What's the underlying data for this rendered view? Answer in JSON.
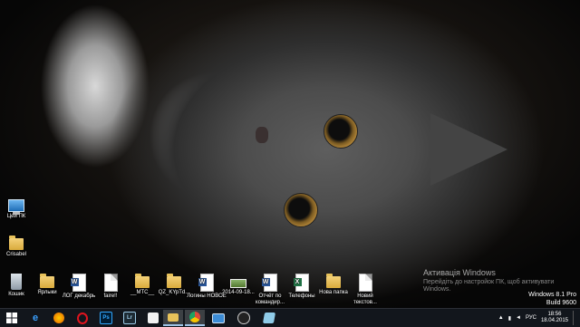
{
  "desktop": {
    "left_icons": [
      {
        "name": "this-pc",
        "label": "Цей ПК",
        "icon": "pc-icon"
      },
      {
        "name": "crisabel",
        "label": "Crisabel",
        "icon": "folder-icon"
      }
    ],
    "bottom_icons": [
      {
        "label": "Кошик",
        "icon": "recycle-bin-icon"
      },
      {
        "label": "Ярлыки",
        "icon": "folder-icon"
      },
      {
        "label": "ЛОГ декабрь",
        "icon": "word-doc-icon"
      },
      {
        "label": "faire!!",
        "icon": "document-icon"
      },
      {
        "label": "__МТС__",
        "icon": "folder-icon"
      },
      {
        "label": "QZ_KYpTd...",
        "icon": "folder-icon"
      },
      {
        "label": "Логины НОВОЕ",
        "icon": "word-doc-icon"
      },
      {
        "label": "2014-09-18...",
        "icon": "image-icon"
      },
      {
        "label": "Отчёт по командир...",
        "icon": "word-doc-icon"
      },
      {
        "label": "Телефоны",
        "icon": "excel-doc-icon"
      },
      {
        "label": "Нова папка",
        "icon": "folder-icon"
      },
      {
        "label": "Новий текстов...",
        "icon": "document-icon"
      }
    ]
  },
  "watermark": {
    "title": "Активація Windows",
    "line1": "Перейдіть до настройок ПК, щоб активувати",
    "line2": "Windows."
  },
  "os_info": {
    "edition": "Windows 8.1 Pro",
    "build": "Build 9600"
  },
  "taskbar": {
    "apps": [
      {
        "name": "ie",
        "glyph": "e",
        "color": "#1e90ff"
      },
      {
        "name": "firefox",
        "glyph": "f",
        "color": "#e66000"
      },
      {
        "name": "opera",
        "glyph": "O",
        "color": "#cc0f16"
      },
      {
        "name": "photoshop",
        "glyph": "Ps",
        "color": "#001d34"
      },
      {
        "name": "lightroom",
        "glyph": "Lr",
        "color": "#1c2a33"
      },
      {
        "name": "paint",
        "glyph": "P",
        "color": "#f2f2f2"
      },
      {
        "name": "explorer",
        "glyph": "",
        "color": "#e8c25a"
      },
      {
        "name": "chrome",
        "glyph": "",
        "color": "#dd4b39"
      },
      {
        "name": "remote-desktop",
        "glyph": "",
        "color": "#3c8cd6"
      },
      {
        "name": "obs",
        "glyph": "",
        "color": "#222"
      },
      {
        "name": "snipping",
        "glyph": "",
        "color": "#8fcbe8"
      }
    ],
    "language": "РУС",
    "time": "18:56",
    "date": "18.04.2015"
  }
}
